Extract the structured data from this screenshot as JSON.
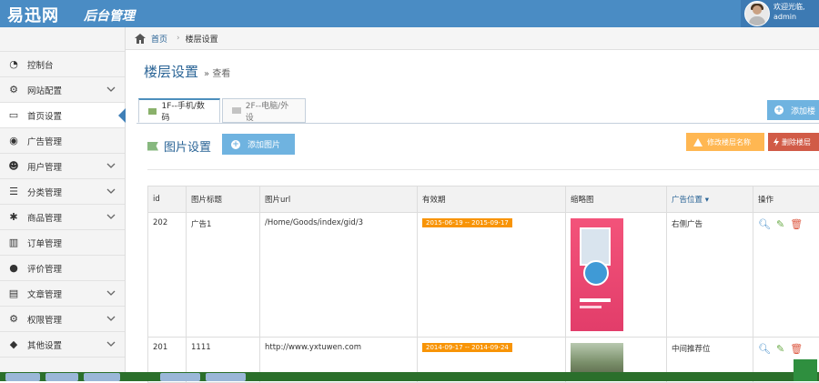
{
  "header": {
    "logo": "易迅网",
    "logo_sub": "后台管理",
    "welcome": "欢迎光临,",
    "username": "admin"
  },
  "sidebar": {
    "items": [
      {
        "label": "控制台",
        "icon": "dashboard-icon",
        "has_chevron": false
      },
      {
        "label": "网站配置",
        "icon": "gear-icon",
        "has_chevron": true
      },
      {
        "label": "首页设置",
        "icon": "monitor-icon",
        "has_chevron": false,
        "active": true
      },
      {
        "label": "广告管理",
        "icon": "eye-icon",
        "has_chevron": false
      },
      {
        "label": "用户管理",
        "icon": "users-icon",
        "has_chevron": true
      },
      {
        "label": "分类管理",
        "icon": "list-icon",
        "has_chevron": true
      },
      {
        "label": "商品管理",
        "icon": "asterisk-icon",
        "has_chevron": true
      },
      {
        "label": "订单管理",
        "icon": "bar-chart-icon",
        "has_chevron": false
      },
      {
        "label": "评价管理",
        "icon": "comment-icon",
        "has_chevron": false
      },
      {
        "label": "文章管理",
        "icon": "book-icon",
        "has_chevron": true
      },
      {
        "label": "权限管理",
        "icon": "cogs-icon",
        "has_chevron": true
      },
      {
        "label": "其他设置",
        "icon": "tag-icon",
        "has_chevron": true
      }
    ]
  },
  "breadcrumb": {
    "home": "首页",
    "current": "楼层设置"
  },
  "page": {
    "title": "楼层设置",
    "subtitle": "» 查看"
  },
  "tabs": [
    {
      "label": "1F--手机/数码"
    },
    {
      "label": "2F--电脑/外设"
    }
  ],
  "actions": {
    "add_floor": "添加楼",
    "add_image": "添加图片",
    "section_title": "图片设置",
    "edit_floor": "修改楼层名称",
    "delete_floor": "删除楼层"
  },
  "table": {
    "headers": [
      "id",
      "图片标题",
      "图片url",
      "有效期",
      "缩略图",
      "广告位置",
      "操作"
    ],
    "rows": [
      {
        "id": "202",
        "title": "广告1",
        "url": "/Home/Goods/index/gid/3",
        "period": "2015-06-19 -- 2015-09-17",
        "position": "右侧广告"
      },
      {
        "id": "201",
        "title": "1111",
        "url": "http://www.yxtuwen.com",
        "period": "2014-09-17 -- 2014-09-24",
        "position": "中间推荐位"
      }
    ]
  },
  "colors": {
    "topbar": "#4a8cc4",
    "accent": "#2a6496",
    "button_info": "#6fb3e0",
    "button_warning": "#ffb752",
    "button_danger": "#d15b47",
    "date_badge": "#f89406"
  }
}
